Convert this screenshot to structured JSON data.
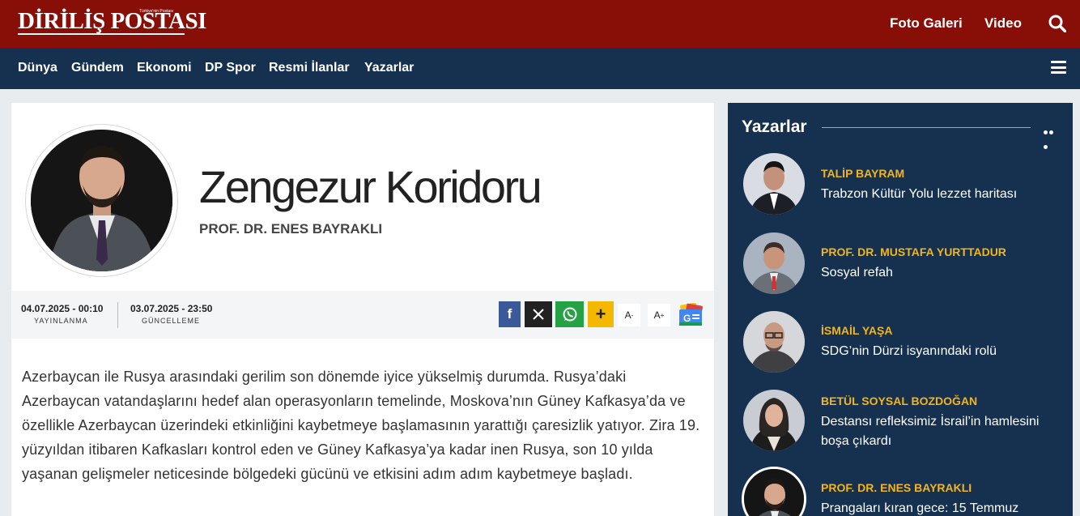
{
  "header": {
    "logo": "DİRİLİŞ POSTASI",
    "logo_tagline": "Türkiye'nin Postası",
    "links": [
      "Foto Galeri",
      "Video"
    ],
    "search_icon": "search-icon"
  },
  "nav": {
    "items": [
      "Dünya",
      "Gündem",
      "Ekonomi",
      "DP Spor",
      "Resmi İlanlar",
      "Yazarlar"
    ],
    "menu_icon": "hamburger-icon"
  },
  "article": {
    "title": "Zengezur Koridoru",
    "author": "PROF. DR. ENES BAYRAKLI",
    "published_date": "04.07.2025 - 00:10",
    "published_label": "YAYINLANMA",
    "updated_date": "03.07.2025 - 23:50",
    "updated_label": "GÜNCELLEME",
    "share": {
      "facebook": "f",
      "x": "𝕏",
      "plus": "+",
      "font_down": "A",
      "font_down_sign": "-",
      "font_up": "A",
      "font_up_sign": "+"
    },
    "body": "Azerbaycan ile Rusya arasındaki gerilim son dönemde iyice yükselmiş durumda. Rusya’daki Azerbaycan vatandaşlarını hedef alan operasyonların temelinde, Moskova’nın Güney Kafkasya’da ve özellikle Azerbaycan üzerindeki etkinliğini kaybetmeye başlamasının yarattığı çaresizlik yatıyor. Zira 19. yüzyıldan itibaren Kafkasları kontrol eden ve Güney Kafkasya’ya kadar inen Rusya, son 10 yılda yaşanan gelişmeler neticesinde bölgedeki gücünü ve etkisini adım adım kaybetmeye başladı."
  },
  "sidebar": {
    "title": "Yazarlar",
    "writers": [
      {
        "name": "TALİP BAYRAM",
        "title": "Trabzon Kültür Yolu lezzet haritası"
      },
      {
        "name": "PROF. DR. MUSTAFA YURTTADUR",
        "title": "Sosyal refah"
      },
      {
        "name": "İSMAİL YAŞA",
        "title": "SDG’nin Dürzi isyanındaki rolü"
      },
      {
        "name": "BETÜL SOYSAL BOZDOĞAN",
        "title": "Destansı refleksimiz İsrail’in hamlesini boşa çıkardı"
      },
      {
        "name": "PROF. DR. ENES BAYRAKLI",
        "title": "Prangaları kıran gece: 15 Temmuz"
      }
    ]
  },
  "colors": {
    "header_red": "#870f08",
    "nav_navy": "#16314f",
    "author_gold": "#f2b51c",
    "facebook": "#3b5998",
    "x": "#222222",
    "whatsapp": "#25a244",
    "plus": "#f5b800"
  }
}
